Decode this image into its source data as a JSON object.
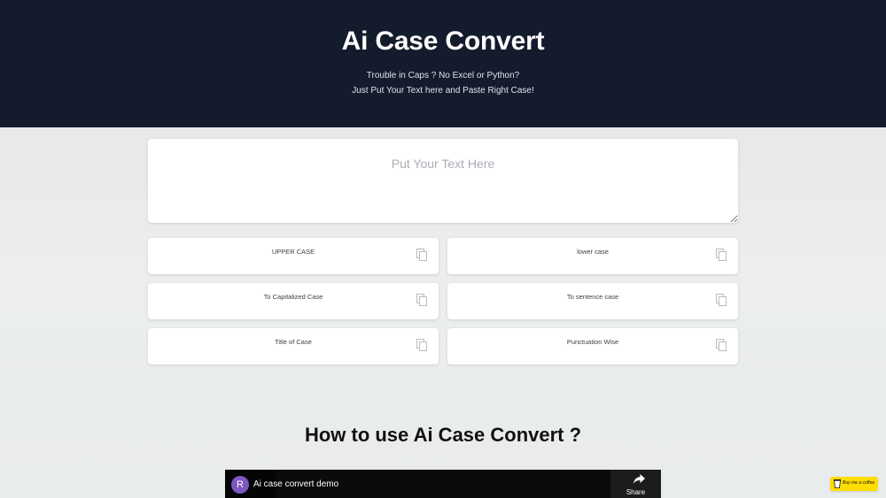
{
  "header": {
    "title": "Ai Case Convert",
    "subtitle_line1": "Trouble in Caps ? No Excel or Python?",
    "subtitle_line2": "Just Put Your Text here and Paste Right Case!"
  },
  "input": {
    "placeholder": "Put Your Text Here",
    "value": ""
  },
  "cases": [
    {
      "label": "UPPER CASE",
      "icon": "copy-icon"
    },
    {
      "label": "lower case",
      "icon": "copy-icon"
    },
    {
      "label": "To Capitalized Case",
      "icon": "copy-icon"
    },
    {
      "label": "To sentence case",
      "icon": "copy-icon"
    },
    {
      "label": "Title of Case",
      "icon": "copy-icon"
    },
    {
      "label": "Punctuation Wise",
      "icon": "copy-icon"
    }
  ],
  "howto": {
    "heading": "How to use Ai Case Convert ?"
  },
  "video": {
    "avatar_letter": "R",
    "title": "Ai case convert demo",
    "share_label": "Share"
  },
  "coffee": {
    "label": "Buy me a coffee"
  },
  "colors": {
    "header_bg": "#141b2d",
    "page_bg": "#e7e9e9",
    "avatar": "#7e57c2",
    "coffee_bg": "#ffdd00"
  }
}
